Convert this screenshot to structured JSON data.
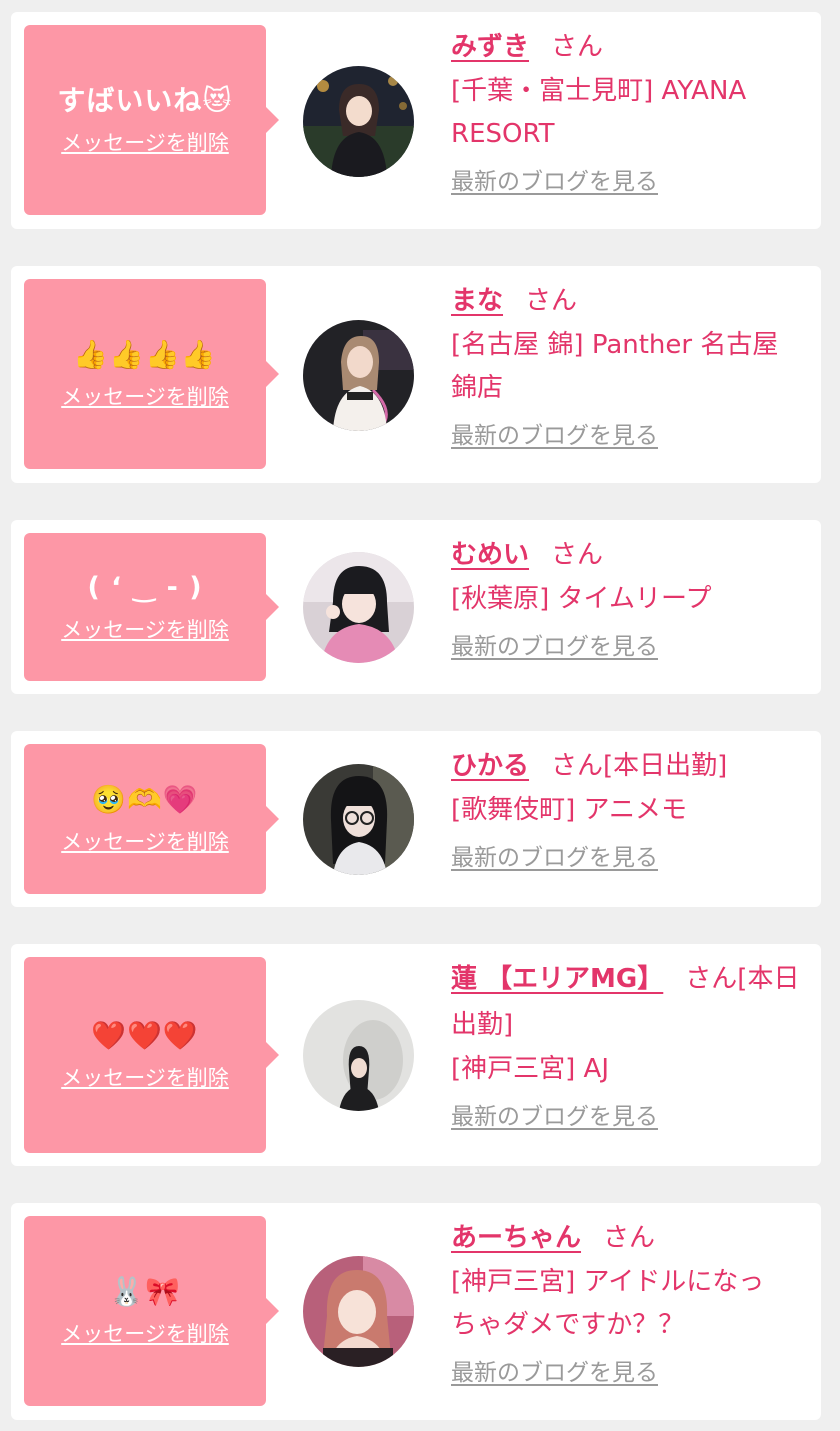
{
  "delete_label": "メッセージを削除",
  "blog_label": "最新のブログを見る",
  "honorific": "さん",
  "colors": {
    "page_bg": "#efefef",
    "card_bg": "#ffffff",
    "bubble": "#fd97a6",
    "accent": "#e3356a",
    "link_gray": "#9a9a9a"
  },
  "messages": [
    {
      "message": "すばいいね😻",
      "name": "みずき",
      "status": "",
      "shop_line1": "[千葉・富士見町] AYANA",
      "shop_line2": "RESORT"
    },
    {
      "message": "👍👍👍👍",
      "name": "まな",
      "status": "",
      "shop_line1": "[名古屋 錦] Panther 名古屋",
      "shop_line2": "錦店"
    },
    {
      "message": "( ‘ ‿ ‐ )",
      "name": "むめい",
      "status": "",
      "shop_line1": "[秋葉原] タイムリープ",
      "shop_line2": ""
    },
    {
      "message": "🥹🫶💗",
      "name": "ひかる",
      "status": "[本日出勤]",
      "shop_line1": "[歌舞伎町] アニメモ",
      "shop_line2": ""
    },
    {
      "message": "❤️❤️❤️",
      "name": "蓮 【エリアMG】",
      "status": "[本日出勤]",
      "shop_line1": "[神戸三宮] AJ",
      "shop_line2": ""
    },
    {
      "message": "🐰🎀",
      "name": "あーちゃん",
      "status": "",
      "shop_line1": "[神戸三宮] アイドルになっ",
      "shop_line2": "ちゃダメですか？？"
    }
  ]
}
